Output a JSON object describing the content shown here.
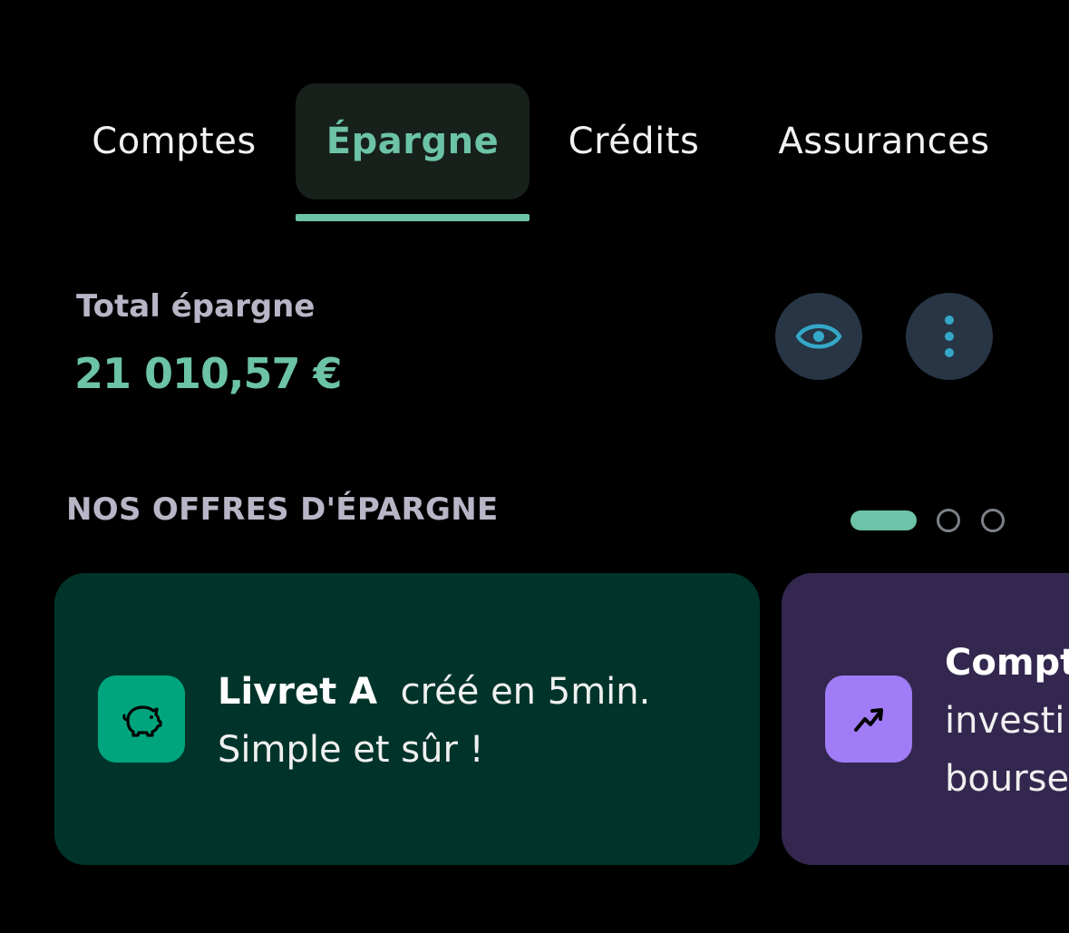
{
  "tabs": [
    {
      "label": "Comptes"
    },
    {
      "label": "Épargne"
    },
    {
      "label": "Crédits"
    },
    {
      "label": "Assurances"
    }
  ],
  "active_tab": "Épargne",
  "summary": {
    "label": "Total épargne",
    "amount": "21 010,57 €"
  },
  "actions": {
    "visibility_icon": "eye-icon",
    "more_icon": "more-vertical-icon"
  },
  "offers": {
    "title": "NOS OFFRES D'ÉPARGNE",
    "pager": {
      "total_pages": 3,
      "current_page": 1
    },
    "cards": [
      {
        "title": "Livret A",
        "line1_suffix": "créé en 5min.",
        "line2": "Simple et sûr !",
        "icon": "piggy-bank-icon",
        "color": "#00342a"
      },
      {
        "title": "Compt",
        "line2": "investi",
        "line3": "bourse",
        "icon": "trending-up-icon",
        "color": "#33274f"
      }
    ]
  },
  "colors": {
    "accent": "#6cc3a7",
    "background": "#000000",
    "muted_text": "#b8b6c6"
  }
}
